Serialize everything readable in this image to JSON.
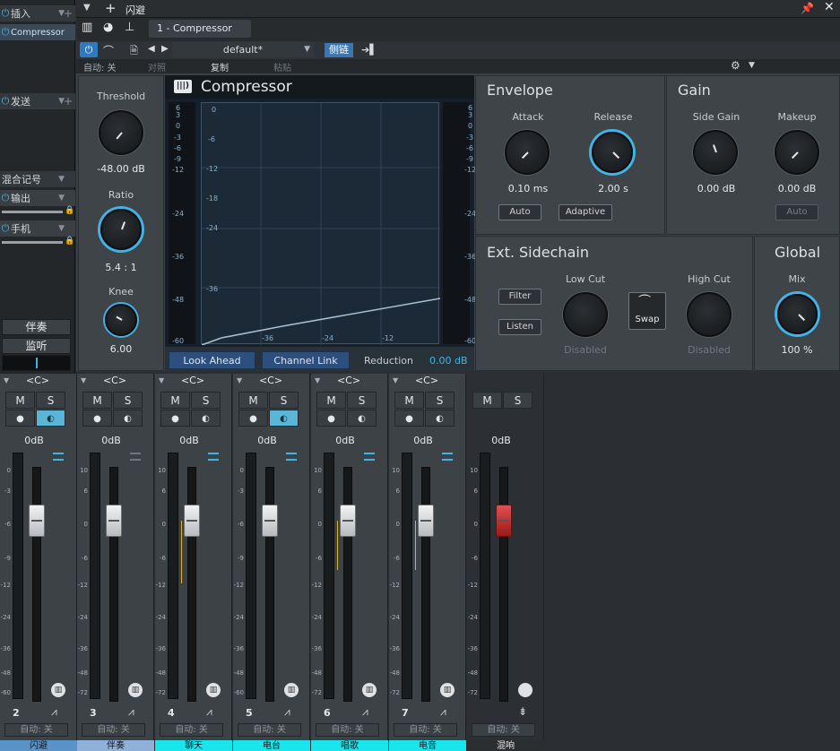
{
  "sidebar": {
    "insert_label": "插入",
    "plugin": "Compressor",
    "send_label": "发送",
    "mix_label": "混合记号",
    "output_label": "输出",
    "phone_label": "手机",
    "btn_accomp": "伴奏",
    "btn_monitor": "监听"
  },
  "top": {
    "title": "闪避",
    "tab": "1 - Compressor",
    "preset": "default*",
    "sidechain": "侧链",
    "auto": "自动: 关",
    "compare": "对照",
    "copy": "复制",
    "paste": "粘贴"
  },
  "comp": {
    "title": "Compressor",
    "threshold_label": "Threshold",
    "threshold_val": "-48.00 dB",
    "ratio_label": "Ratio",
    "ratio_val": "5.4 : 1",
    "knee_label": "Knee",
    "knee_val": "6.00",
    "look_ahead": "Look Ahead",
    "channel_link": "Channel Link",
    "reduction_label": "Reduction",
    "reduction_val": "0.00 dB",
    "left_scale": [
      "6",
      "3",
      "0",
      "-3",
      "-6",
      "-9",
      "-12",
      "-24",
      "-36",
      "-48",
      "-60"
    ],
    "graph_y": [
      "0",
      "-6",
      "-12",
      "-18",
      "-24",
      "-36"
    ],
    "graph_x": [
      "-36",
      "-24",
      "-12"
    ]
  },
  "envelope": {
    "title": "Envelope",
    "attack_label": "Attack",
    "attack_val": "0.10 ms",
    "release_label": "Release",
    "release_val": "2.00 s",
    "auto": "Auto",
    "adaptive": "Adaptive"
  },
  "gain": {
    "title": "Gain",
    "side_label": "Side Gain",
    "side_val": "0.00 dB",
    "makeup_label": "Makeup",
    "makeup_val": "0.00 dB",
    "auto": "Auto"
  },
  "sidechain": {
    "title": "Ext. Sidechain",
    "filter": "Filter",
    "listen": "Listen",
    "low_label": "Low Cut",
    "low_val": "Disabled",
    "swap": "Swap",
    "high_label": "High Cut",
    "high_val": "Disabled"
  },
  "global": {
    "title": "Global",
    "mix_label": "Mix",
    "mix_val": "100 %"
  },
  "mixer": {
    "pan": "<C>",
    "m": "M",
    "s": "S",
    "vol": "0dB",
    "auto": "自动: 关",
    "scale": [
      "10",
      "6",
      "0",
      "-6",
      "-12",
      "-24",
      "-36",
      "-48",
      "-72"
    ],
    "scale_first": [
      "0",
      "-3",
      "-6",
      "-9",
      "-12",
      "-24",
      "-36",
      "-48",
      "-60"
    ],
    "channels": [
      {
        "num": "2",
        "name": "闪避",
        "name_color": "#5a93c7"
      },
      {
        "num": "3",
        "name": "伴奏",
        "name_color": "#8fb0d8"
      },
      {
        "num": "4",
        "name": "聊天",
        "name_color": "#19e6ec"
      },
      {
        "num": "5",
        "name": "电台",
        "name_color": "#19e6ec"
      },
      {
        "num": "6",
        "name": "唱歌",
        "name_color": "#19e6ec"
      },
      {
        "num": "7",
        "name": "电音",
        "name_color": "#19e6ec"
      },
      {
        "num": "",
        "name": "混响",
        "name_color": "#2a2e31"
      }
    ]
  }
}
